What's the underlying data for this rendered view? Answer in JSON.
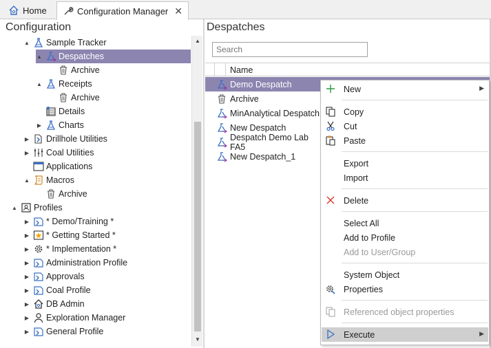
{
  "tabs": [
    {
      "label": "Home",
      "icon": "home-icon"
    },
    {
      "label": "Configuration Manager",
      "icon": "wrench-icon",
      "close": "✕"
    }
  ],
  "left": {
    "title": "Configuration",
    "tree": [
      {
        "label": "Sample Tracker",
        "indent": 2,
        "arrow": "▲",
        "icon": "flask-icon"
      },
      {
        "label": "Despatches",
        "indent": 3,
        "arrow": "▲",
        "icon": "despatch-icon",
        "selected": true
      },
      {
        "label": "Archive",
        "indent": 4,
        "arrow": "",
        "icon": "trash-icon"
      },
      {
        "label": "Receipts",
        "indent": 3,
        "arrow": "▲",
        "icon": "flask-icon"
      },
      {
        "label": "Archive",
        "indent": 4,
        "arrow": "",
        "icon": "trash-icon"
      },
      {
        "label": "Details",
        "indent": 3,
        "arrow": "",
        "icon": "details-icon"
      },
      {
        "label": "Charts",
        "indent": 3,
        "arrow": "▶",
        "icon": "flask-icon"
      },
      {
        "label": "Drillhole Utilities",
        "indent": 2,
        "arrow": "▶",
        "icon": "drillhole-icon"
      },
      {
        "label": "Coal Utilities",
        "indent": 2,
        "arrow": "▶",
        "icon": "coal-icon"
      },
      {
        "label": "Applications",
        "indent": 2,
        "arrow": "",
        "icon": "window-icon"
      },
      {
        "label": "Macros",
        "indent": 2,
        "arrow": "▲",
        "icon": "scroll-icon"
      },
      {
        "label": "Archive",
        "indent": 3,
        "arrow": "",
        "icon": "trash-icon"
      },
      {
        "label": "Profiles",
        "indent": 1,
        "arrow": "▲",
        "icon": "profile-card-icon"
      },
      {
        "label": "* Demo/Training *",
        "indent": 2,
        "arrow": "▶",
        "icon": "profile-icon"
      },
      {
        "label": "* Getting Started *",
        "indent": 2,
        "arrow": "▶",
        "icon": "star-icon"
      },
      {
        "label": "* Implementation *",
        "indent": 2,
        "arrow": "▶",
        "icon": "gear-icon"
      },
      {
        "label": "Administration Profile",
        "indent": 2,
        "arrow": "▶",
        "icon": "profile-icon"
      },
      {
        "label": "Approvals",
        "indent": 2,
        "arrow": "▶",
        "icon": "profile-icon"
      },
      {
        "label": "Coal Profile",
        "indent": 2,
        "arrow": "▶",
        "icon": "profile-icon"
      },
      {
        "label": "DB Admin",
        "indent": 2,
        "arrow": "▶",
        "icon": "house-user-icon"
      },
      {
        "label": "Exploration Manager",
        "indent": 2,
        "arrow": "▶",
        "icon": "person-icon"
      },
      {
        "label": "General Profile",
        "indent": 2,
        "arrow": "▶",
        "icon": "profile-icon"
      }
    ]
  },
  "right": {
    "title": "Despatches",
    "search_placeholder": "Search",
    "column_name": "Name",
    "rows": [
      {
        "label": "Demo Despatch",
        "icon": "despatch-icon",
        "selected": true
      },
      {
        "label": "Archive",
        "icon": "trash-icon"
      },
      {
        "label": "MinAnalytical Despatch",
        "icon": "despatch-icon"
      },
      {
        "label": "New Despatch",
        "icon": "despatch-icon"
      },
      {
        "label": "Despatch Demo Lab FA5",
        "icon": "despatch-icon"
      },
      {
        "label": "New Despatch_1",
        "icon": "despatch-icon"
      }
    ]
  },
  "context_menu": {
    "items": [
      {
        "label": "New",
        "icon": "plus-icon",
        "submenu": true
      },
      {
        "sep": true
      },
      {
        "label": "Copy",
        "icon": "copy-icon"
      },
      {
        "label": "Cut",
        "icon": "scissors-icon"
      },
      {
        "label": "Paste",
        "icon": "paste-icon"
      },
      {
        "sep": true
      },
      {
        "label": "Export"
      },
      {
        "label": "Import"
      },
      {
        "sep": true
      },
      {
        "label": "Delete",
        "icon": "delete-x-icon"
      },
      {
        "sep": true
      },
      {
        "label": "Select All"
      },
      {
        "label": "Add to Profile"
      },
      {
        "label": "Add to User/Group",
        "disabled": true
      },
      {
        "sep": true
      },
      {
        "label": "System Object"
      },
      {
        "label": "Properties",
        "icon": "properties-icon"
      },
      {
        "sep": true
      },
      {
        "label": "Referenced object properties",
        "icon": "ref-props-icon",
        "disabled": true
      },
      {
        "sep": true
      },
      {
        "label": "Execute",
        "icon": "play-icon",
        "submenu": true,
        "highlight": true
      }
    ],
    "submenu_arrow": "▶"
  },
  "colors": {
    "selection": "#8c85b0",
    "icon_blue": "#3a6fc4",
    "icon_purple": "#8a3fa8",
    "delete_red": "#d9342b",
    "plus_green": "#2e9a3e"
  }
}
